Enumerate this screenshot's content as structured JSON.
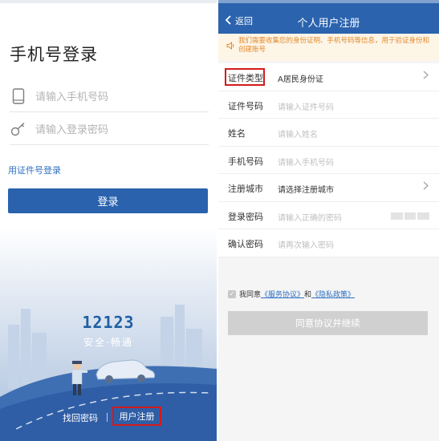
{
  "login": {
    "title": "手机号登录",
    "phone_placeholder": "请输入手机号码",
    "password_placeholder": "请输入登录密码",
    "id_login_link": "用证件号登录",
    "login_button": "登录",
    "brand_number": "12123",
    "brand_slogan": "安全·畅通",
    "forgot_password": "找回密码",
    "register": "用户注册"
  },
  "register": {
    "nav": {
      "back_label": "返回",
      "title": "个人用户注册"
    },
    "notice": "我们需要收集您的身份证明、手机号码等信息，用于验证身份和创建账号",
    "fields": [
      {
        "label": "证件类型",
        "value": "A居民身份证",
        "placeholder": false,
        "arrow": true
      },
      {
        "label": "证件号码",
        "value": "请输入证件号码",
        "placeholder": true,
        "arrow": false
      },
      {
        "label": "姓名",
        "value": "请输入姓名",
        "placeholder": true,
        "arrow": false
      },
      {
        "label": "手机号码",
        "value": "请输入手机号码",
        "placeholder": true,
        "arrow": false
      },
      {
        "label": "注册城市",
        "value": "请选择注册城市",
        "placeholder": false,
        "arrow": true
      },
      {
        "label": "登录密码",
        "value": "请输入正确的密码",
        "placeholder": true,
        "arrow": false
      },
      {
        "label": "确认密码",
        "value": "请再次输入密码",
        "placeholder": true,
        "arrow": false
      }
    ],
    "agreement": {
      "prefix": "我同意",
      "service_link": "《服务协议》",
      "and": "和",
      "privacy_link": "《隐私政策》"
    },
    "agree_button": "同意协议并继续"
  },
  "colors": {
    "primary": "#2a62ad",
    "highlight": "#d41a1a",
    "notice_text": "#e48a2d",
    "notice_bg": "#fdf5e6"
  }
}
